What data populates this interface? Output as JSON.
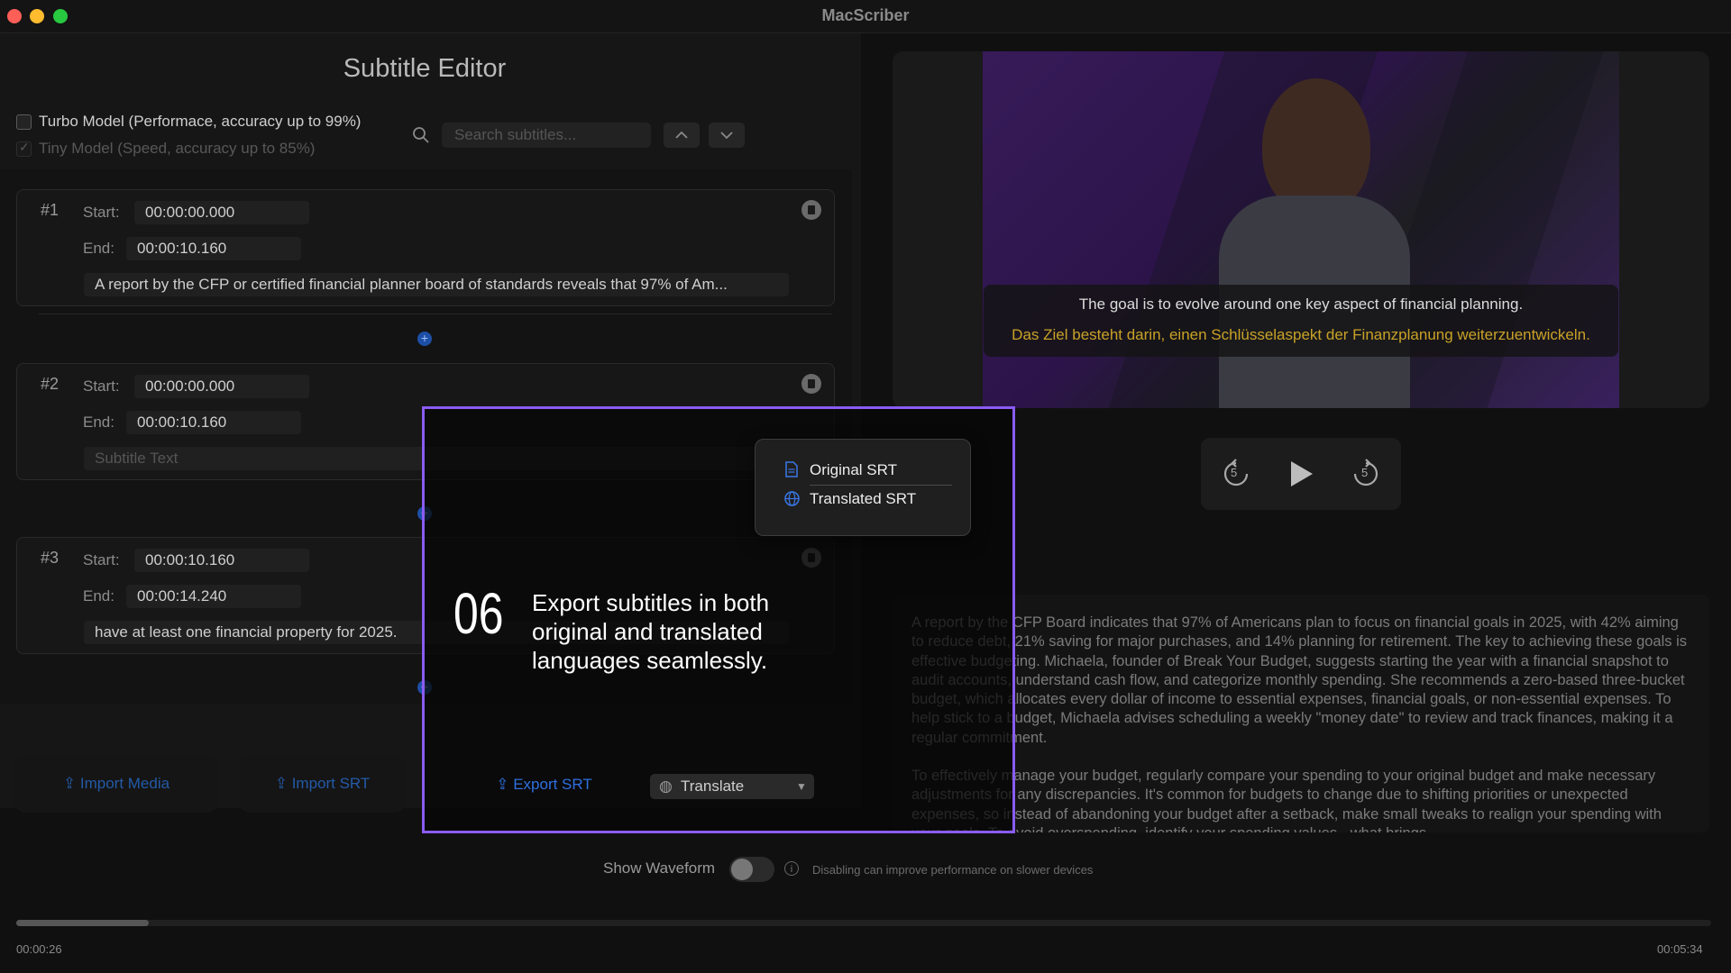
{
  "window": {
    "title": "MacScriber"
  },
  "editor": {
    "title": "Subtitle Editor",
    "models": [
      {
        "label": "Turbo Model (Performace, accuracy up to 99%)",
        "checked": false
      },
      {
        "label": "Tiny Model (Speed, accuracy up to 85%)",
        "checked": true
      }
    ],
    "search": {
      "placeholder": "Search subtitles..."
    },
    "start_label": "Start:",
    "end_label": "End:",
    "subtitles": [
      {
        "index": "#1",
        "start": "00:00:00.000",
        "end": "00:00:10.160",
        "text": "A report by the CFP or certified financial planner board of standards reveals that 97% of Am..."
      },
      {
        "index": "#2",
        "start": "00:00:00.000",
        "end": "00:00:10.160",
        "text": "",
        "placeholder": "Subtitle Text"
      },
      {
        "index": "#3",
        "start": "00:00:10.160",
        "end": "00:00:14.240",
        "text": "have at least one financial property for 2025."
      }
    ],
    "buttons": {
      "import_media": "Import Media",
      "import_srt": "Import SRT",
      "export_srt": "Export SRT",
      "translate": "Translate"
    }
  },
  "export_menu": {
    "items": [
      "Original SRT",
      "Translated SRT"
    ]
  },
  "callout": {
    "number": "06",
    "text": "Export subtitles in both original and translated languages seamlessly."
  },
  "video": {
    "subtitle_original": "The goal is to evolve around one key aspect of financial planning.",
    "subtitle_translated": "Das Ziel besteht darin, einen Schlüsselaspekt der Finanzplanung weiterzuentwickeln."
  },
  "player": {
    "skip_back_label": "5",
    "skip_forward_label": "5"
  },
  "transcript": {
    "paragraph1": "A report by the CFP Board indicates that 97% of Americans plan to focus on financial goals in 2025, with 42% aiming to reduce debt, 21% saving for major purchases, and 14% planning for retirement. The key to achieving these goals is effective budgeting. Michaela, founder of Break Your Budget, suggests starting the year with a financial snapshot to audit accounts, understand cash flow, and categorize monthly spending. She recommends a zero-based three-bucket budget, which allocates every dollar of income to essential expenses, financial goals, or non-essential expenses. To help stick to a budget, Michaela advises scheduling a weekly \"money date\" to review and track finances, making it a regular commitment.",
    "paragraph2": "To effectively manage your budget, regularly compare your spending to your original budget and make necessary adjustments for any discrepancies. It's common for budgets to change due to shifting priorities or unexpected expenses, so instead of abandoning your budget after a setback, make small tweaks to realign your spending with your goals. To avoid overspending, identify your spending values - what brings"
  },
  "waveform": {
    "label": "Show Waveform",
    "enabled": false,
    "hint": "Disabling can improve performance on slower devices"
  },
  "timeline": {
    "current": "00:00:26",
    "total": "00:05:34",
    "progress": 0.078
  },
  "colors": {
    "accent": "#2f6fe0",
    "highlight": "#8a5cf5",
    "translated_subtitle": "#c9a227"
  }
}
